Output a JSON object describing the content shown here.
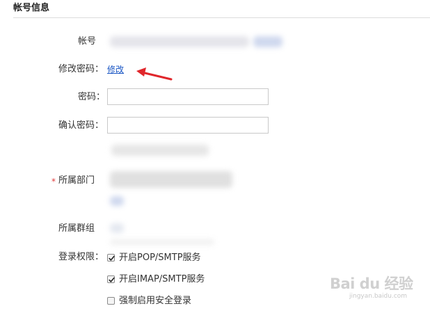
{
  "section": {
    "title": "帐号信息"
  },
  "fields": {
    "account_label": "帐号",
    "change_password_label": "修改密码：",
    "change_password_link": "修改",
    "password_label": "密码：",
    "password_value": "",
    "confirm_password_label": "确认密码：",
    "confirm_password_value": "",
    "department_required_mark": "*",
    "department_label": "所属部门",
    "group_label": "所属群组",
    "login_permission_label": "登录权限："
  },
  "permissions": [
    {
      "label": "开启POP/SMTP服务",
      "checked": true
    },
    {
      "label": "开启IMAP/SMTP服务",
      "checked": true
    },
    {
      "label": "强制启用安全登录",
      "checked": false
    }
  ],
  "annotation": {
    "arrow_color": "#e0262b"
  },
  "watermark": {
    "main": "Bai du 经验",
    "sub": "jingyan.baidu.com"
  },
  "colors": {
    "link": "#1a56c4",
    "required": "#e03b3b",
    "divider": "#dcdcdc"
  }
}
